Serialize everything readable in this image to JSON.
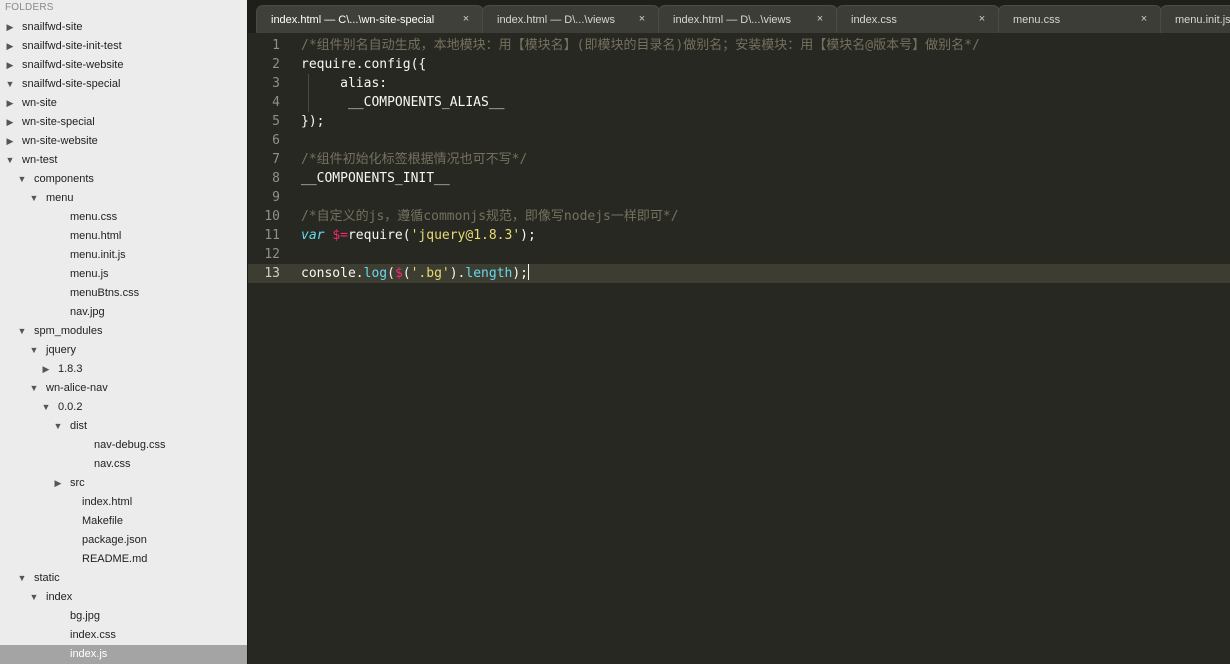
{
  "sidebar": {
    "header": "FOLDERS",
    "tree": [
      {
        "label": "snailfwd-site",
        "arrow": "▶"
      },
      {
        "label": "snailfwd-site-init-test",
        "arrow": "▶"
      },
      {
        "label": "snailfwd-site-website",
        "arrow": "▶"
      },
      {
        "label": "snailfwd-site-special",
        "arrow": "▼"
      },
      {
        "label": "wn-site",
        "arrow": "▶"
      },
      {
        "label": "wn-site-special",
        "arrow": "▶"
      },
      {
        "label": "wn-site-website",
        "arrow": "▶"
      },
      {
        "label": "wn-test",
        "arrow": "▼"
      },
      {
        "label": "components",
        "arrow": "▼"
      },
      {
        "label": "menu",
        "arrow": "▼"
      },
      {
        "label": "menu.css",
        "arrow": ""
      },
      {
        "label": "menu.html",
        "arrow": ""
      },
      {
        "label": "menu.init.js",
        "arrow": ""
      },
      {
        "label": "menu.js",
        "arrow": ""
      },
      {
        "label": "menuBtns.css",
        "arrow": ""
      },
      {
        "label": "nav.jpg",
        "arrow": ""
      },
      {
        "label": "spm_modules",
        "arrow": "▼"
      },
      {
        "label": "jquery",
        "arrow": "▼"
      },
      {
        "label": "1.8.3",
        "arrow": "▶"
      },
      {
        "label": "wn-alice-nav",
        "arrow": "▼"
      },
      {
        "label": "0.0.2",
        "arrow": "▼"
      },
      {
        "label": "dist",
        "arrow": "▼"
      },
      {
        "label": "nav-debug.css",
        "arrow": ""
      },
      {
        "label": "nav.css",
        "arrow": ""
      },
      {
        "label": "src",
        "arrow": "▶"
      },
      {
        "label": "index.html",
        "arrow": ""
      },
      {
        "label": "Makefile",
        "arrow": ""
      },
      {
        "label": "package.json",
        "arrow": ""
      },
      {
        "label": "README.md",
        "arrow": ""
      },
      {
        "label": "static",
        "arrow": "▼"
      },
      {
        "label": "index",
        "arrow": "▼"
      },
      {
        "label": "bg.jpg",
        "arrow": ""
      },
      {
        "label": "index.css",
        "arrow": ""
      },
      {
        "label": "index.js",
        "arrow": ""
      }
    ]
  },
  "tabs": [
    {
      "label": "index.html — C\\...\\wn-site-special",
      "close": "×"
    },
    {
      "label": "index.html — D\\...\\views",
      "close": "×"
    },
    {
      "label": "index.html — D\\...\\views",
      "close": "×"
    },
    {
      "label": "index.css",
      "close": "×"
    },
    {
      "label": "menu.css",
      "close": "×"
    },
    {
      "label": "menu.init.js",
      "close": ""
    }
  ],
  "editor": {
    "lines": [
      {
        "number": "1",
        "tokens": [
          {
            "t": "comment",
            "v": "/*组件别名自动生成，本地模块：用【模块名】(即模块的目录名)做别名；安装模块：用【模块名@版本号】做别名*/"
          }
        ]
      },
      {
        "number": "2",
        "tokens": [
          {
            "t": "plain",
            "v": "require.config({"
          }
        ]
      },
      {
        "number": "3",
        "tokens": [
          {
            "t": "plain",
            "v": "     alias:"
          }
        ]
      },
      {
        "number": "4",
        "tokens": [
          {
            "t": "plain",
            "v": "      __COMPONENTS_ALIAS__"
          }
        ]
      },
      {
        "number": "5",
        "tokens": [
          {
            "t": "plain",
            "v": "});"
          }
        ]
      },
      {
        "number": "6",
        "tokens": []
      },
      {
        "number": "7",
        "tokens": [
          {
            "t": "comment",
            "v": "/*组件初始化标签根据情况也可不写*/"
          }
        ]
      },
      {
        "number": "8",
        "tokens": [
          {
            "t": "plain",
            "v": "__COMPONENTS_INIT__"
          }
        ]
      },
      {
        "number": "9",
        "tokens": []
      },
      {
        "number": "10",
        "tokens": [
          {
            "t": "comment",
            "v": "/*自定义的js，遵循commonjs规范，即像写nodejs一样即可*/"
          }
        ]
      },
      {
        "number": "11",
        "tokens": [
          {
            "t": "keyword",
            "v": "var"
          },
          {
            "t": "plain",
            "v": " "
          },
          {
            "t": "var",
            "v": "$="
          },
          {
            "t": "plain",
            "v": "require("
          },
          {
            "t": "string",
            "v": "'jquery@1.8.3'"
          },
          {
            "t": "plain",
            "v": ");"
          }
        ]
      },
      {
        "number": "12",
        "tokens": []
      },
      {
        "number": "13",
        "tokens": [
          {
            "t": "plain",
            "v": "console."
          },
          {
            "t": "func",
            "v": "log"
          },
          {
            "t": "plain",
            "v": "("
          },
          {
            "t": "var",
            "v": "$"
          },
          {
            "t": "plain",
            "v": "("
          },
          {
            "t": "string",
            "v": "'.bg'"
          },
          {
            "t": "plain",
            "v": ")."
          },
          {
            "t": "func",
            "v": "length"
          },
          {
            "t": "plain",
            "v": ");"
          }
        ]
      }
    ]
  }
}
